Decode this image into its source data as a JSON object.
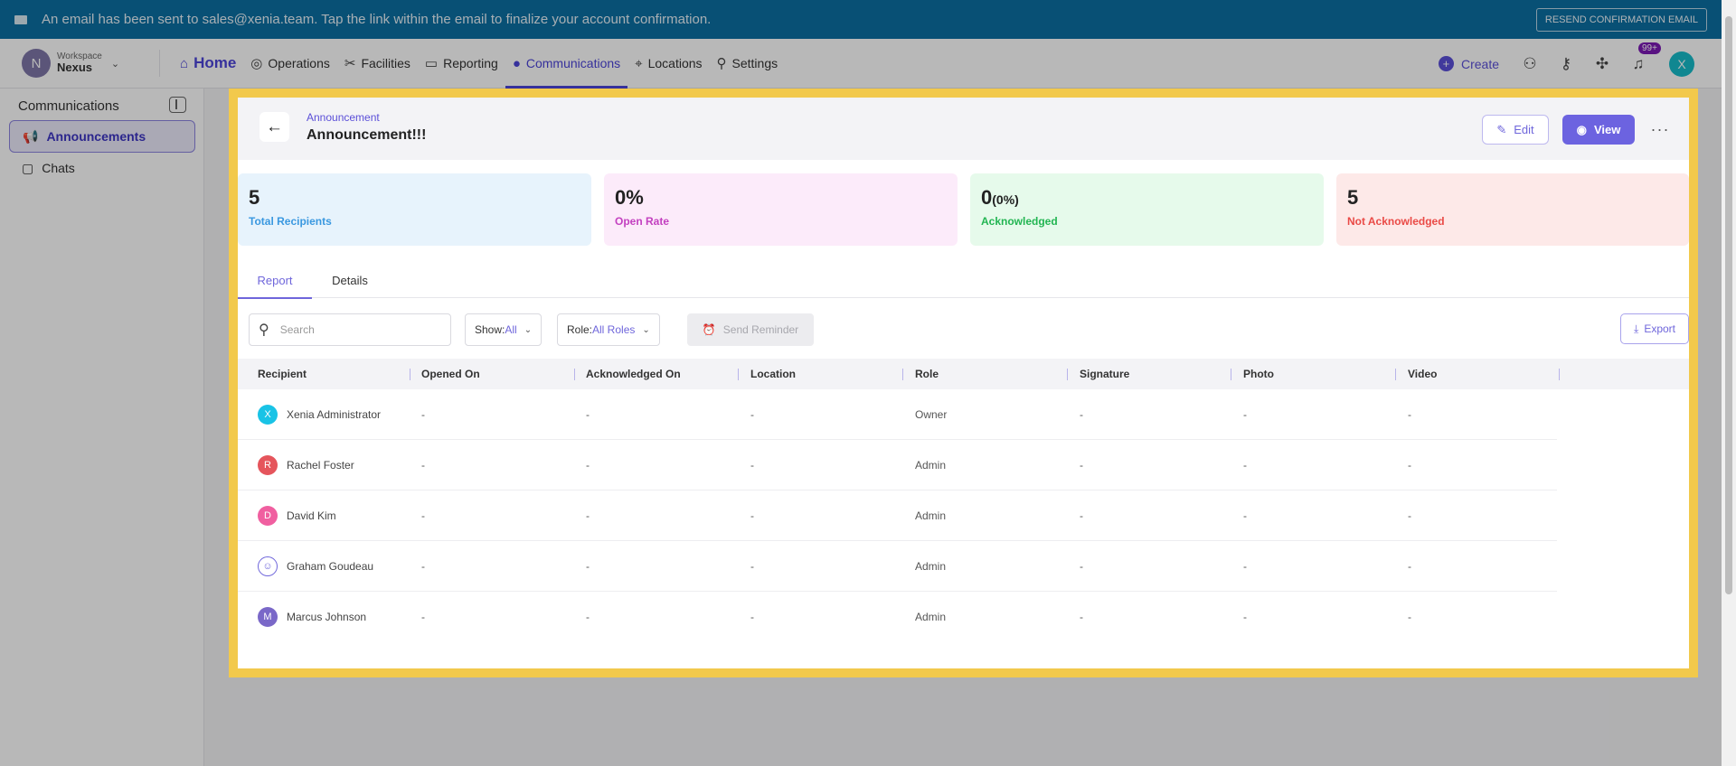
{
  "banner": {
    "message": "An email has been sent to sales@xenia.team. Tap the link within the email to finalize your account confirmation.",
    "resend_label": "RESEND CONFIRMATION EMAIL"
  },
  "workspace": {
    "label": "Workspace",
    "name": "Nexus",
    "initial": "N"
  },
  "nav": {
    "home": "Home",
    "operations": "Operations",
    "facilities": "Facilities",
    "reporting": "Reporting",
    "communications": "Communications",
    "locations": "Locations",
    "settings": "Settings",
    "create": "Create",
    "notif_badge": "99+",
    "user_initial": "X"
  },
  "sidebar": {
    "title": "Communications",
    "items": [
      {
        "label": "Announcements",
        "icon": "megaphone-icon",
        "active": true
      },
      {
        "label": "Chats",
        "icon": "chat-icon",
        "active": false
      }
    ]
  },
  "header": {
    "breadcrumb": "Announcement",
    "title": "Announcement!!!",
    "edit_label": "Edit",
    "view_label": "View",
    "more_label": "···"
  },
  "stats": [
    {
      "value": "5",
      "sub": "",
      "label": "Total Recipients",
      "bg": "#e7f3fc",
      "color": "#3a98e0"
    },
    {
      "value": "0%",
      "sub": "",
      "label": "Open Rate",
      "bg": "#fcebfa",
      "color": "#c340c0"
    },
    {
      "value": "0",
      "sub": "(0%)",
      "label": "Acknowledged",
      "bg": "#e6faeb",
      "color": "#22b552"
    },
    {
      "value": "5",
      "sub": "",
      "label": "Not Acknowledged",
      "bg": "#fde9e8",
      "color": "#ea4a46"
    }
  ],
  "tabs": {
    "report": "Report",
    "details": "Details"
  },
  "toolbar": {
    "search_placeholder": "Search",
    "show_prefix": "Show:",
    "show_value": "All",
    "role_prefix": "Role:",
    "role_value": "All Roles",
    "send_reminder": "Send Reminder",
    "export": "Export"
  },
  "table": {
    "columns": [
      "Recipient",
      "Opened On",
      "Acknowledged On",
      "Location",
      "Role",
      "Signature",
      "Photo",
      "Video"
    ],
    "rows": [
      {
        "name": "Xenia Administrator",
        "initial": "X",
        "avatar_color": "#19c3e6",
        "avatar_type": "letter",
        "opened_on": "-",
        "acknowledged_on": "-",
        "location": "-",
        "role": "Owner",
        "signature": "-",
        "photo": "-",
        "video": "-"
      },
      {
        "name": "Rachel Foster",
        "initial": "R",
        "avatar_color": "#e5555c",
        "avatar_type": "letter",
        "opened_on": "-",
        "acknowledged_on": "-",
        "location": "-",
        "role": "Admin",
        "signature": "-",
        "photo": "-",
        "video": "-"
      },
      {
        "name": "David Kim",
        "initial": "D",
        "avatar_color": "#f05fa0",
        "avatar_type": "letter",
        "opened_on": "-",
        "acknowledged_on": "-",
        "location": "-",
        "role": "Admin",
        "signature": "-",
        "photo": "-",
        "video": "-"
      },
      {
        "name": "Graham Goudeau",
        "initial": "",
        "avatar_color": "#6f66db",
        "avatar_type": "user-outline-icon",
        "opened_on": "-",
        "acknowledged_on": "-",
        "location": "-",
        "role": "Admin",
        "signature": "-",
        "photo": "-",
        "video": "-"
      },
      {
        "name": "Marcus Johnson",
        "initial": "M",
        "avatar_color": "#7a68c8",
        "avatar_type": "letter",
        "opened_on": "-",
        "acknowledged_on": "-",
        "location": "-",
        "role": "Admin",
        "signature": "-",
        "photo": "-",
        "video": "-"
      }
    ]
  }
}
